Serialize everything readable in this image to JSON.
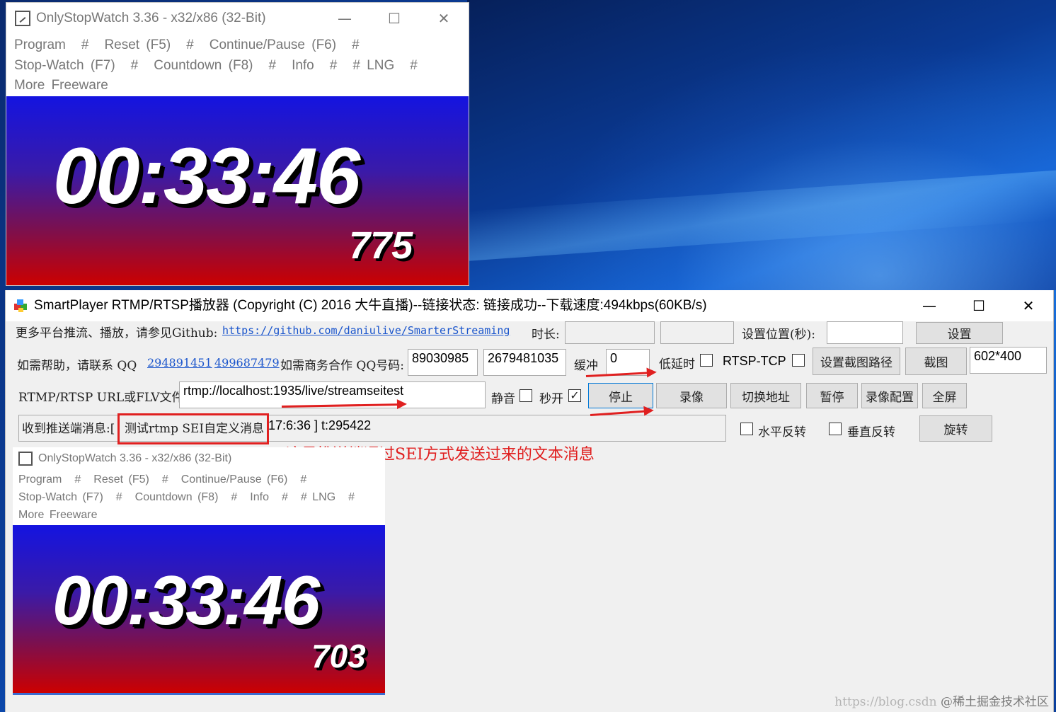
{
  "stopwatch_top": {
    "title": "OnlyStopWatch 3.36 - x32/x86 (32-Bit)",
    "menu": [
      "Program",
      "#",
      "Reset (F5)",
      "#",
      "Continue/Pause (F6)",
      "#",
      "Stop-Watch (F7)",
      "#",
      "Countdown (F8)",
      "#",
      "Info",
      "#",
      "# LNG",
      "#",
      "More Freeware"
    ],
    "time": "00:33:46",
    "ms": "775"
  },
  "window_controls": {
    "minimize": "—",
    "maximize": "☐",
    "close": "✕"
  },
  "player": {
    "title": "SmartPlayer RTMP/RTSP播放器 (Copyright (C) 2016 大牛直播)--链接状态: 链接成功--下载速度:494kbps(60KB/s)",
    "row1": {
      "more_text": "更多平台推流、播放，请参见Github:",
      "github_link": "https://github.com/daniulive/SmarterStreaming",
      "duration_label": "时长:",
      "duration_value1": "",
      "duration_value2": "",
      "set_position_label": "设置位置(秒):",
      "set_position_value": "",
      "set_button": "设置"
    },
    "row2": {
      "help_text": "如需帮助，请联系 QQ",
      "qq1": "294891451",
      "qq2": "499687479",
      "business_text": "如需商务合作 QQ号码:",
      "biz_qq1": "89030985",
      "biz_qq2": "2679481035",
      "buffer_label": "缓冲",
      "buffer_value": "0",
      "low_latency_label": "低延时",
      "rtsp_tcp_label": "RTSP-TCP",
      "set_snapshot_path_button": "设置截图路径",
      "snapshot_button": "截图",
      "resolution": "602*400"
    },
    "row3": {
      "url_label": "RTMP/RTSP URL或FLV文件:",
      "url_value": "rtmp://localhost:1935/live/streamseitest",
      "mute_label": "静音",
      "fast_open_label": "秒开",
      "fast_open_checked": "✓",
      "stop_button": "停止",
      "record_button": "录像",
      "switch_url_button": "切换地址",
      "pause_button": "暂停",
      "record_config_button": "录像配置",
      "fullscreen_button": "全屏"
    },
    "row4": {
      "received_label": "收到推送端消息:[",
      "sei_message": "测试rtmp SEI自定义消息",
      "time_text": "17:6:36 ] t:295422",
      "hflip_label": "水平反转",
      "vflip_label": "垂直反转",
      "rotate_button": "旋转"
    },
    "annotation": "这是推送端通过SEI方式发送过来的文本消息"
  },
  "stopwatch_embedded": {
    "title": "OnlyStopWatch 3.36 - x32/x86 (32-Bit)",
    "menu": [
      "Program",
      "#",
      "Reset (F5)",
      "#",
      "Continue/Pause (F6)",
      "#",
      "Stop-Watch (F7)",
      "#",
      "Countdown (F8)",
      "#",
      "Info",
      "#",
      "# LNG",
      "#",
      "More Freeware"
    ],
    "time": "00:33:46",
    "ms": "703"
  },
  "watermark": {
    "url": "https://blog.csdn",
    "site": "@稀土掘金技术社区"
  },
  "colors": {
    "annotation_red": "#e02020",
    "link_blue": "#1a55cc"
  }
}
